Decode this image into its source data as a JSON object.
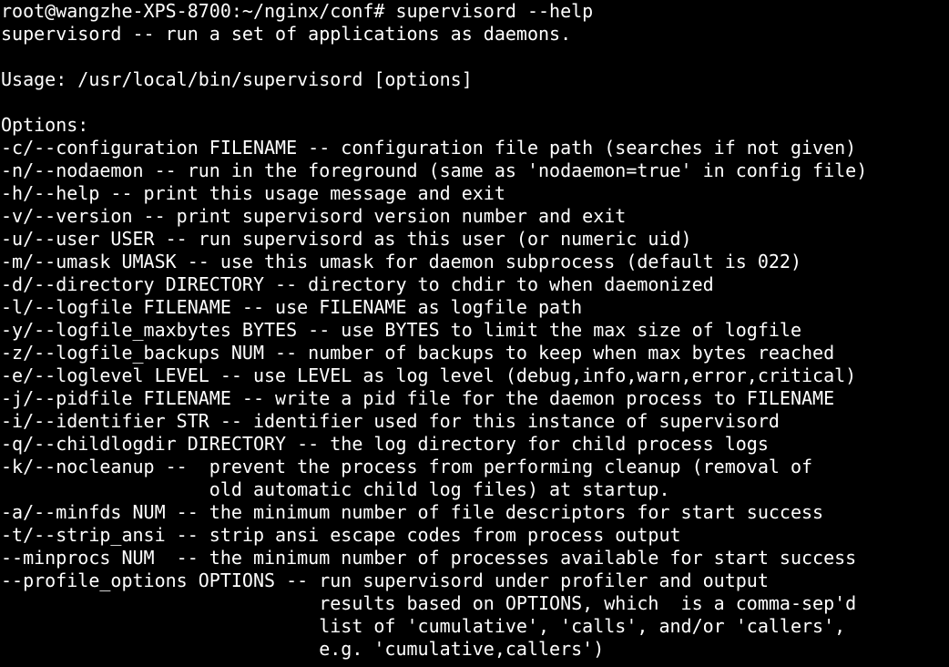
{
  "terminal": {
    "prompt": "root@wangzhe-XPS-8700:~/nginx/conf# supervisord --help",
    "lines": [
      "supervisord -- run a set of applications as daemons.",
      "",
      "Usage: /usr/local/bin/supervisord [options]",
      "",
      "Options:",
      "-c/--configuration FILENAME -- configuration file path (searches if not given)",
      "-n/--nodaemon -- run in the foreground (same as 'nodaemon=true' in config file)",
      "-h/--help -- print this usage message and exit",
      "-v/--version -- print supervisord version number and exit",
      "-u/--user USER -- run supervisord as this user (or numeric uid)",
      "-m/--umask UMASK -- use this umask for daemon subprocess (default is 022)",
      "-d/--directory DIRECTORY -- directory to chdir to when daemonized",
      "-l/--logfile FILENAME -- use FILENAME as logfile path",
      "-y/--logfile_maxbytes BYTES -- use BYTES to limit the max size of logfile",
      "-z/--logfile_backups NUM -- number of backups to keep when max bytes reached",
      "-e/--loglevel LEVEL -- use LEVEL as log level (debug,info,warn,error,critical)",
      "-j/--pidfile FILENAME -- write a pid file for the daemon process to FILENAME",
      "-i/--identifier STR -- identifier used for this instance of supervisord",
      "-q/--childlogdir DIRECTORY -- the log directory for child process logs",
      "-k/--nocleanup --  prevent the process from performing cleanup (removal of",
      "                   old automatic child log files) at startup.",
      "-a/--minfds NUM -- the minimum number of file descriptors for start success",
      "-t/--strip_ansi -- strip ansi escape codes from process output",
      "--minprocs NUM  -- the minimum number of processes available for start success",
      "--profile_options OPTIONS -- run supervisord under profiler and output",
      "                             results based on OPTIONS, which  is a comma-sep'd",
      "                             list of 'cumulative', 'calls', and/or 'callers',",
      "                             e.g. 'cumulative,callers')"
    ]
  },
  "colors": {
    "background": "#000000",
    "foreground": "#ffffff"
  }
}
